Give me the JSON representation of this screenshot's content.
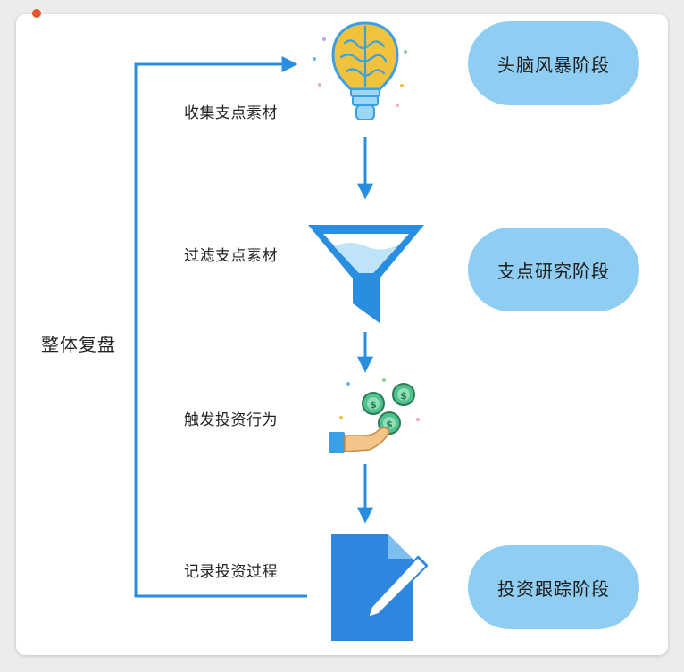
{
  "loop_label": "整体复盘",
  "steps": [
    {
      "label": "收集支点素材"
    },
    {
      "label": "过滤支点素材"
    },
    {
      "label": "触发投资行为"
    },
    {
      "label": "记录投资过程"
    }
  ],
  "stages": [
    {
      "label": "头脑风暴阶段"
    },
    {
      "label": "支点研究阶段"
    },
    {
      "label": "投资跟踪阶段"
    }
  ],
  "icons": [
    "brain-bulb-icon",
    "funnel-icon",
    "coins-hand-icon",
    "document-pen-icon"
  ],
  "colors": {
    "arrow": "#2a8ee0",
    "pill": "#8fcdf2",
    "funnel": "#2a8ee0",
    "document": "#2e86de",
    "bulb": "#f1c23b",
    "coin": "#52c28c"
  }
}
